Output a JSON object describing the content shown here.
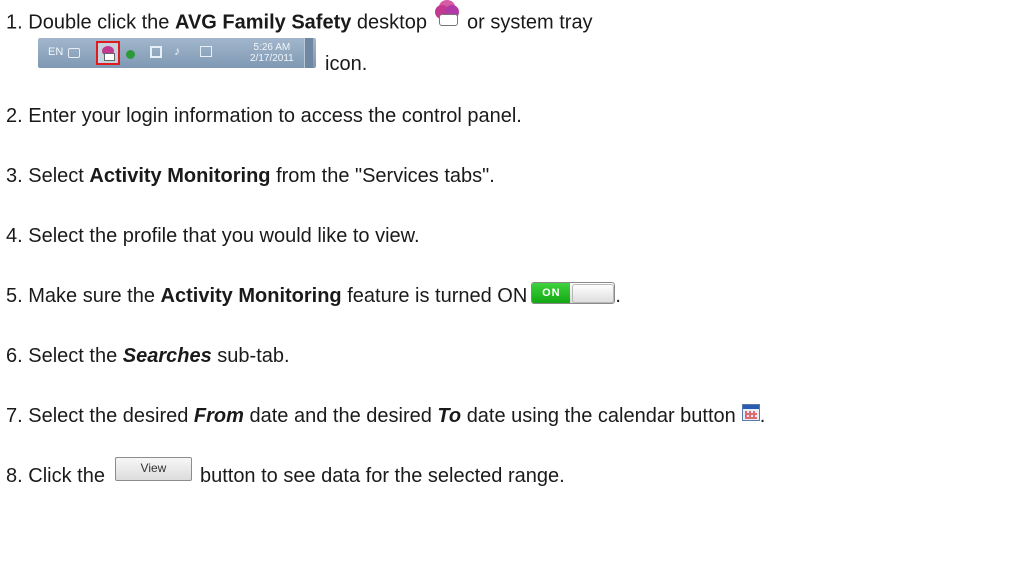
{
  "steps": [
    {
      "num": "1.",
      "pre": "Double click the",
      "bold": "AVG Family Safety",
      "mid": "desktop",
      "post": "or system tray",
      "end": "icon."
    },
    {
      "num": "2.",
      "text": "Enter your login information to access the control panel."
    },
    {
      "num": "3.",
      "pre": "Select",
      "bold": "Activity Monitoring",
      "post": "from the \"Services tabs\"."
    },
    {
      "num": "4.",
      "text": "Select the profile that you would like to view."
    },
    {
      "num": "5.",
      "pre": "Make sure the",
      "bold": "Activity Monitoring",
      "post": "feature is turned ON",
      "end": "."
    },
    {
      "num": "6.",
      "pre": "Select the",
      "bold": "Searches",
      "post": "sub-tab."
    },
    {
      "num": "7.",
      "pre": "Select the desired",
      "bold1": "From",
      "mid": "date and the desired",
      "bold2": "To",
      "post": "date using the calendar button",
      "end": "."
    },
    {
      "num": "8.",
      "pre": "Click the",
      "post": "button to see data for the selected range."
    }
  ],
  "tray": {
    "lang": "EN",
    "time": "5:26 AM",
    "date": "2/17/2011"
  },
  "toggle": {
    "label": "ON"
  },
  "view_button": {
    "label": "View"
  },
  "colors": {
    "highlight": "#e01b1b",
    "toggle_on": "#13a813",
    "app_icon": "#c2398f"
  }
}
